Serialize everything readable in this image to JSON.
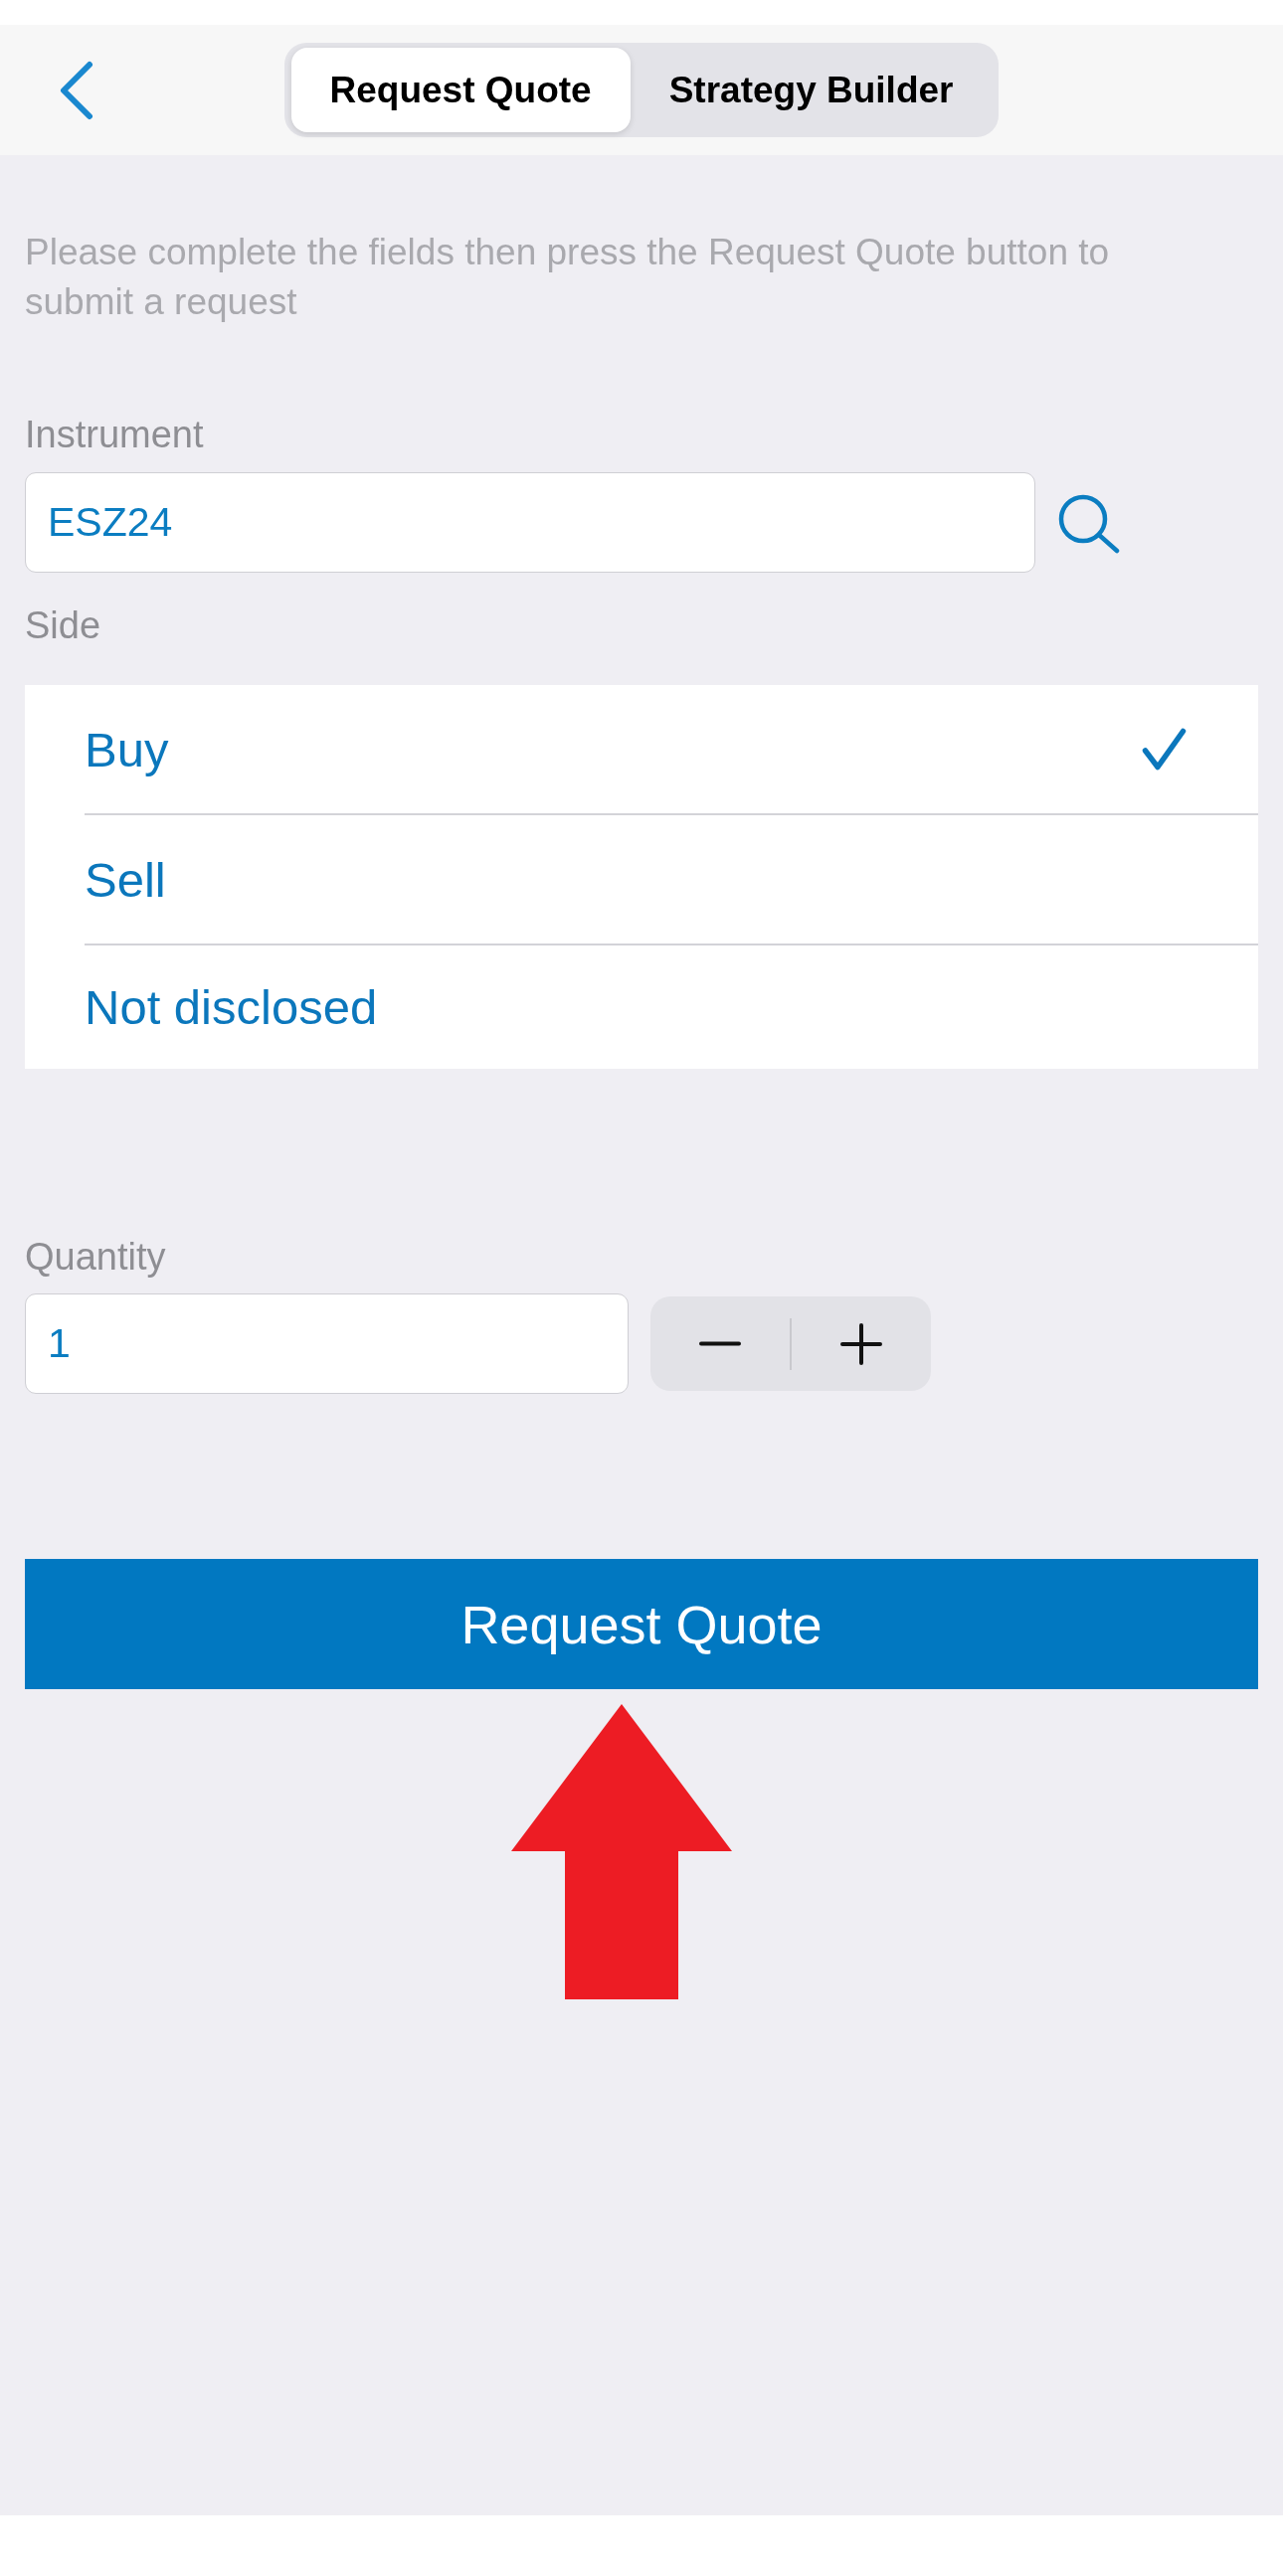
{
  "segmented_tabs": [
    {
      "label": "Request Quote",
      "selected": true
    },
    {
      "label": "Strategy Builder",
      "selected": false
    }
  ],
  "instructions": "Please complete the fields then press the Request Quote button to submit a request",
  "instrument": {
    "label": "Instrument",
    "value": "ESZ24"
  },
  "side": {
    "label": "Side",
    "options": [
      {
        "label": "Buy",
        "selected": true
      },
      {
        "label": "Sell",
        "selected": false
      },
      {
        "label": "Not disclosed",
        "selected": false
      }
    ]
  },
  "quantity": {
    "label": "Quantity",
    "value": "1"
  },
  "submit_button": {
    "label": "Request Quote"
  }
}
